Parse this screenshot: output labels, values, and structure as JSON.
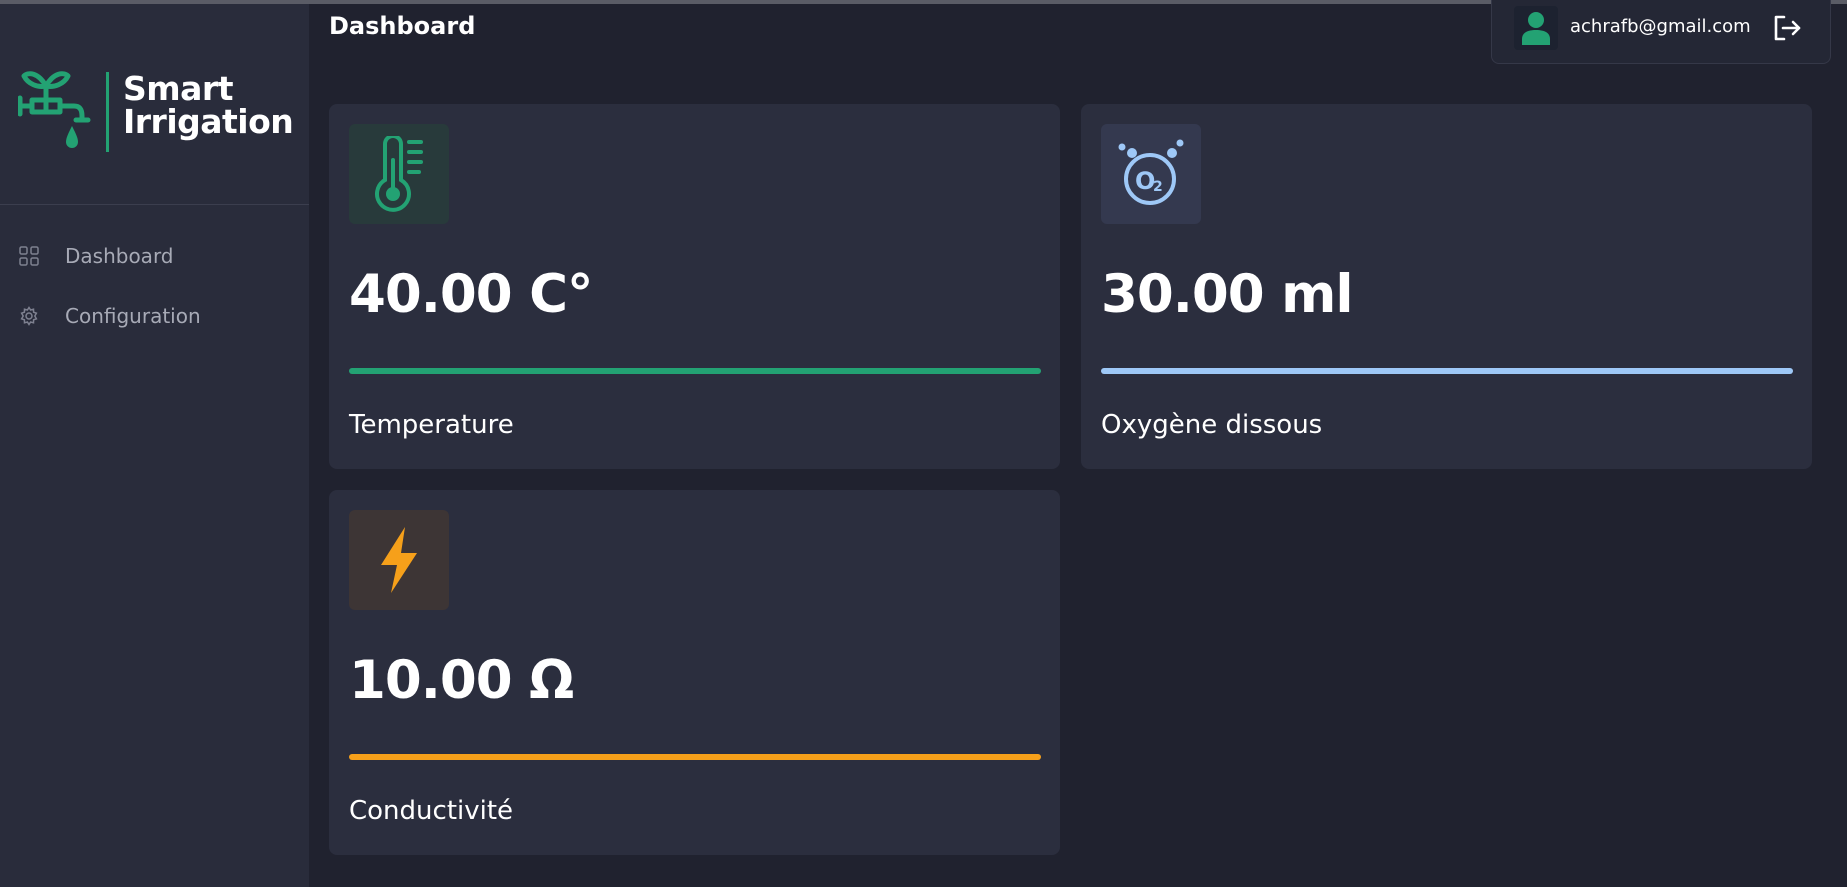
{
  "app": {
    "brand_line1": "Smart",
    "brand_line2": "Irrigation",
    "brand_color": "#23a273"
  },
  "sidebar": {
    "items": [
      {
        "label": "Dashboard",
        "icon": "grid-icon"
      },
      {
        "label": "Configuration",
        "icon": "gear-icon"
      }
    ]
  },
  "header": {
    "title": "Dashboard",
    "user_email": "achrafb@gmail.com"
  },
  "cards": [
    {
      "value": "40.00 C°",
      "label": "Temperature",
      "icon": "thermometer-icon",
      "accent": "#23a273",
      "icon_bg": "#283a3b",
      "progress": 1.0
    },
    {
      "value": "30.00 ml",
      "label": "Oxygène dissous",
      "icon": "oxygen-icon",
      "accent": "#9ec8f7",
      "icon_bg": "#34394f",
      "progress": 1.0
    },
    {
      "value": "10.00 Ω",
      "label": "Conductivité",
      "icon": "lightning-icon",
      "accent": "#f6a01a",
      "icon_bg": "#3d3535",
      "progress": 1.0
    }
  ]
}
